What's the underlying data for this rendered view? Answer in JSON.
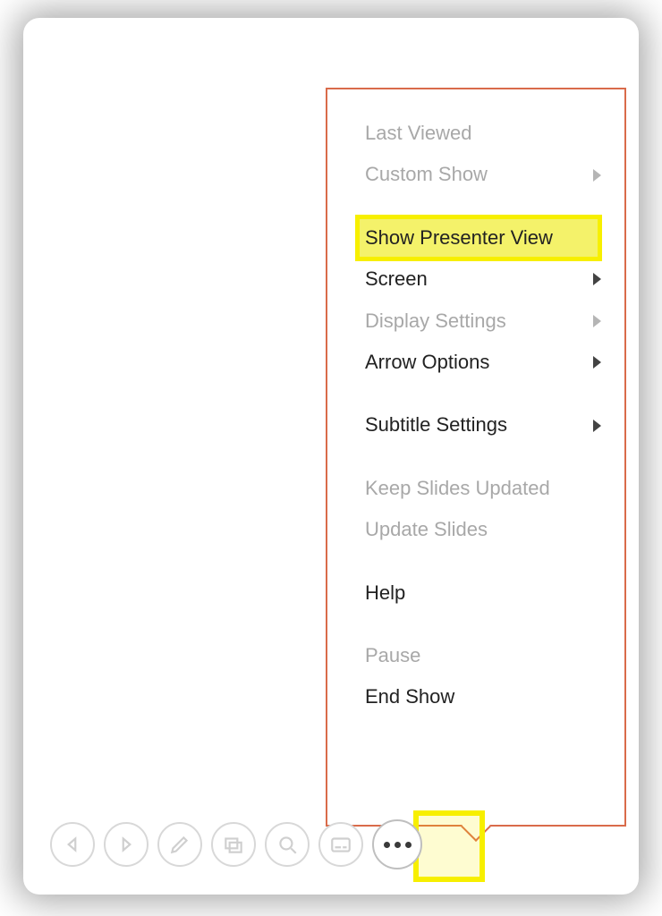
{
  "menu": {
    "items": [
      {
        "label": "Last Viewed",
        "enabled": false,
        "submenu": false
      },
      {
        "label": "Custom Show",
        "enabled": false,
        "submenu": true
      },
      {
        "sep": true
      },
      {
        "label": "Show Presenter View",
        "enabled": true,
        "submenu": false,
        "highlight": true
      },
      {
        "label": "Screen",
        "enabled": true,
        "submenu": true
      },
      {
        "label": "Display Settings",
        "enabled": false,
        "submenu": true
      },
      {
        "label": "Arrow Options",
        "enabled": true,
        "submenu": true
      },
      {
        "sep": true
      },
      {
        "label": "Subtitle Settings",
        "enabled": true,
        "submenu": true
      },
      {
        "sep": true
      },
      {
        "label": "Keep Slides Updated",
        "enabled": false,
        "submenu": false
      },
      {
        "label": "Update Slides",
        "enabled": false,
        "submenu": false
      },
      {
        "sep": true
      },
      {
        "label": "Help",
        "enabled": true,
        "submenu": false
      },
      {
        "sep": true
      },
      {
        "label": "Pause",
        "enabled": false,
        "submenu": false
      },
      {
        "label": "End Show",
        "enabled": true,
        "submenu": false
      }
    ]
  },
  "toolbar": {
    "buttons": [
      {
        "name": "previous-slide-button",
        "icon": "triangle-left-icon"
      },
      {
        "name": "next-slide-button",
        "icon": "triangle-right-icon"
      },
      {
        "name": "pen-tool-button",
        "icon": "pen-icon"
      },
      {
        "name": "see-all-slides-button",
        "icon": "slides-grid-icon"
      },
      {
        "name": "zoom-button",
        "icon": "magnifier-icon"
      },
      {
        "name": "subtitles-button",
        "icon": "subtitles-icon"
      },
      {
        "name": "more-options-button",
        "icon": "more-icon",
        "highlight": true
      }
    ]
  }
}
